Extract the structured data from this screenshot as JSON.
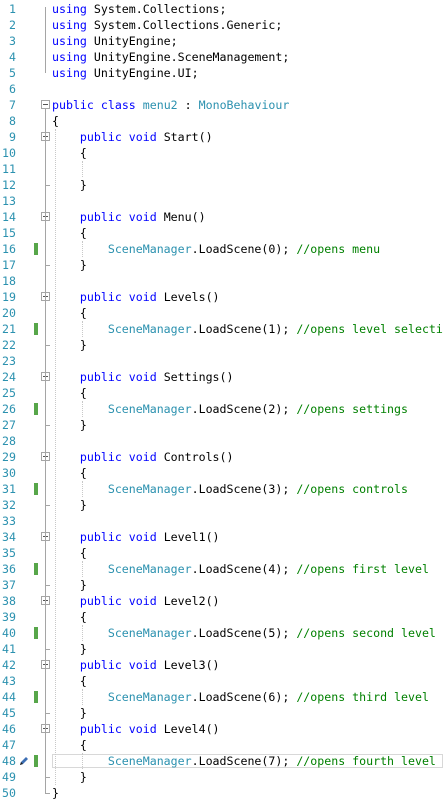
{
  "lines": [
    {
      "n": "1",
      "indent": "",
      "parts": [
        {
          "c": "kw",
          "t": "using"
        },
        {
          "c": "",
          "t": " System.Collections;"
        }
      ]
    },
    {
      "n": "2",
      "indent": "",
      "parts": [
        {
          "c": "kw",
          "t": "using"
        },
        {
          "c": "",
          "t": " System.Collections.Generic;"
        }
      ]
    },
    {
      "n": "3",
      "indent": "",
      "parts": [
        {
          "c": "kw",
          "t": "using"
        },
        {
          "c": "",
          "t": " UnityEngine;"
        }
      ]
    },
    {
      "n": "4",
      "indent": "",
      "parts": [
        {
          "c": "kw",
          "t": "using"
        },
        {
          "c": "",
          "t": " UnityEngine.SceneManagement;"
        }
      ]
    },
    {
      "n": "5",
      "indent": "",
      "parts": [
        {
          "c": "kw",
          "t": "using"
        },
        {
          "c": "",
          "t": " UnityEngine.UI;"
        }
      ]
    },
    {
      "n": "6",
      "indent": "",
      "parts": []
    },
    {
      "n": "7",
      "fold": true,
      "indent": "",
      "parts": [
        {
          "c": "kw",
          "t": "public"
        },
        {
          "c": "",
          "t": " "
        },
        {
          "c": "kw",
          "t": "class"
        },
        {
          "c": "",
          "t": " "
        },
        {
          "c": "ty",
          "t": "menu2"
        },
        {
          "c": "",
          "t": " : "
        },
        {
          "c": "ty",
          "t": "MonoBehaviour"
        }
      ]
    },
    {
      "n": "8",
      "indent": "",
      "parts": [
        {
          "c": "",
          "t": "{"
        }
      ]
    },
    {
      "n": "9",
      "fold": true,
      "indent": "    ",
      "parts": [
        {
          "c": "kw",
          "t": "public"
        },
        {
          "c": "",
          "t": " "
        },
        {
          "c": "kw",
          "t": "void"
        },
        {
          "c": "",
          "t": " Start()"
        }
      ]
    },
    {
      "n": "10",
      "indent": "    ",
      "parts": [
        {
          "c": "",
          "t": "{"
        }
      ]
    },
    {
      "n": "11",
      "indent": "",
      "parts": []
    },
    {
      "n": "12",
      "indent": "    ",
      "parts": [
        {
          "c": "",
          "t": "}"
        }
      ]
    },
    {
      "n": "13",
      "indent": "",
      "parts": []
    },
    {
      "n": "14",
      "fold": true,
      "indent": "    ",
      "parts": [
        {
          "c": "kw",
          "t": "public"
        },
        {
          "c": "",
          "t": " "
        },
        {
          "c": "kw",
          "t": "void"
        },
        {
          "c": "",
          "t": " Menu()"
        }
      ]
    },
    {
      "n": "15",
      "indent": "    ",
      "parts": [
        {
          "c": "",
          "t": "{"
        }
      ]
    },
    {
      "n": "16",
      "changed": true,
      "indent": "        ",
      "parts": [
        {
          "c": "ty",
          "t": "SceneManager"
        },
        {
          "c": "",
          "t": ".LoadScene(0); "
        },
        {
          "c": "cm",
          "t": "//opens menu"
        }
      ]
    },
    {
      "n": "17",
      "indent": "    ",
      "parts": [
        {
          "c": "",
          "t": "}"
        }
      ]
    },
    {
      "n": "18",
      "indent": "",
      "parts": []
    },
    {
      "n": "19",
      "fold": true,
      "indent": "    ",
      "parts": [
        {
          "c": "kw",
          "t": "public"
        },
        {
          "c": "",
          "t": " "
        },
        {
          "c": "kw",
          "t": "void"
        },
        {
          "c": "",
          "t": " Levels()"
        }
      ]
    },
    {
      "n": "20",
      "indent": "    ",
      "parts": [
        {
          "c": "",
          "t": "{"
        }
      ]
    },
    {
      "n": "21",
      "changed": true,
      "indent": "        ",
      "parts": [
        {
          "c": "ty",
          "t": "SceneManager"
        },
        {
          "c": "",
          "t": ".LoadScene(1); "
        },
        {
          "c": "cm",
          "t": "//opens level selection"
        }
      ]
    },
    {
      "n": "22",
      "indent": "    ",
      "parts": [
        {
          "c": "",
          "t": "}"
        }
      ]
    },
    {
      "n": "23",
      "indent": "",
      "parts": []
    },
    {
      "n": "24",
      "fold": true,
      "indent": "    ",
      "parts": [
        {
          "c": "kw",
          "t": "public"
        },
        {
          "c": "",
          "t": " "
        },
        {
          "c": "kw",
          "t": "void"
        },
        {
          "c": "",
          "t": " Settings()"
        }
      ]
    },
    {
      "n": "25",
      "indent": "    ",
      "parts": [
        {
          "c": "",
          "t": "{"
        }
      ]
    },
    {
      "n": "26",
      "changed": true,
      "indent": "        ",
      "parts": [
        {
          "c": "ty",
          "t": "SceneManager"
        },
        {
          "c": "",
          "t": ".LoadScene(2); "
        },
        {
          "c": "cm",
          "t": "//opens settings"
        }
      ]
    },
    {
      "n": "27",
      "indent": "    ",
      "parts": [
        {
          "c": "",
          "t": "}"
        }
      ]
    },
    {
      "n": "28",
      "indent": "",
      "parts": []
    },
    {
      "n": "29",
      "fold": true,
      "indent": "    ",
      "parts": [
        {
          "c": "kw",
          "t": "public"
        },
        {
          "c": "",
          "t": " "
        },
        {
          "c": "kw",
          "t": "void"
        },
        {
          "c": "",
          "t": " Controls()"
        }
      ]
    },
    {
      "n": "30",
      "indent": "    ",
      "parts": [
        {
          "c": "",
          "t": "{"
        }
      ]
    },
    {
      "n": "31",
      "changed": true,
      "indent": "        ",
      "parts": [
        {
          "c": "ty",
          "t": "SceneManager"
        },
        {
          "c": "",
          "t": ".LoadScene(3); "
        },
        {
          "c": "cm",
          "t": "//opens controls"
        }
      ]
    },
    {
      "n": "32",
      "indent": "    ",
      "parts": [
        {
          "c": "",
          "t": "}"
        }
      ]
    },
    {
      "n": "33",
      "indent": "",
      "parts": []
    },
    {
      "n": "34",
      "fold": true,
      "indent": "    ",
      "parts": [
        {
          "c": "kw",
          "t": "public"
        },
        {
          "c": "",
          "t": " "
        },
        {
          "c": "kw",
          "t": "void"
        },
        {
          "c": "",
          "t": " Level1()"
        }
      ]
    },
    {
      "n": "35",
      "indent": "    ",
      "parts": [
        {
          "c": "",
          "t": "{"
        }
      ]
    },
    {
      "n": "36",
      "changed": true,
      "indent": "        ",
      "parts": [
        {
          "c": "ty",
          "t": "SceneManager"
        },
        {
          "c": "",
          "t": ".LoadScene(4); "
        },
        {
          "c": "cm",
          "t": "//opens first level"
        }
      ]
    },
    {
      "n": "37",
      "indent": "    ",
      "parts": [
        {
          "c": "",
          "t": "}"
        }
      ]
    },
    {
      "n": "38",
      "fold": true,
      "indent": "    ",
      "parts": [
        {
          "c": "kw",
          "t": "public"
        },
        {
          "c": "",
          "t": " "
        },
        {
          "c": "kw",
          "t": "void"
        },
        {
          "c": "",
          "t": " Level2()"
        }
      ]
    },
    {
      "n": "39",
      "indent": "    ",
      "parts": [
        {
          "c": "",
          "t": "{"
        }
      ]
    },
    {
      "n": "40",
      "changed": true,
      "indent": "        ",
      "parts": [
        {
          "c": "ty",
          "t": "SceneManager"
        },
        {
          "c": "",
          "t": ".LoadScene(5); "
        },
        {
          "c": "cm",
          "t": "//opens second level"
        }
      ]
    },
    {
      "n": "41",
      "indent": "    ",
      "parts": [
        {
          "c": "",
          "t": "}"
        }
      ]
    },
    {
      "n": "42",
      "fold": true,
      "indent": "    ",
      "parts": [
        {
          "c": "kw",
          "t": "public"
        },
        {
          "c": "",
          "t": " "
        },
        {
          "c": "kw",
          "t": "void"
        },
        {
          "c": "",
          "t": " Level3()"
        }
      ]
    },
    {
      "n": "43",
      "indent": "    ",
      "parts": [
        {
          "c": "",
          "t": "{"
        }
      ]
    },
    {
      "n": "44",
      "changed": true,
      "indent": "        ",
      "parts": [
        {
          "c": "ty",
          "t": "SceneManager"
        },
        {
          "c": "",
          "t": ".LoadScene(6); "
        },
        {
          "c": "cm",
          "t": "//opens third level"
        }
      ]
    },
    {
      "n": "45",
      "indent": "    ",
      "parts": [
        {
          "c": "",
          "t": "}"
        }
      ]
    },
    {
      "n": "46",
      "fold": true,
      "indent": "    ",
      "parts": [
        {
          "c": "kw",
          "t": "public"
        },
        {
          "c": "",
          "t": " "
        },
        {
          "c": "kw",
          "t": "void"
        },
        {
          "c": "",
          "t": " Level4()"
        }
      ]
    },
    {
      "n": "47",
      "indent": "    ",
      "parts": [
        {
          "c": "",
          "t": "{"
        }
      ]
    },
    {
      "n": "48",
      "changed": true,
      "current": true,
      "indent": "        ",
      "parts": [
        {
          "c": "ty",
          "t": "SceneManager"
        },
        {
          "c": "",
          "t": ".LoadScene(7); "
        },
        {
          "c": "cm",
          "t": "//opens fourth level"
        }
      ]
    },
    {
      "n": "49",
      "indent": "    ",
      "parts": [
        {
          "c": "",
          "t": "}"
        }
      ]
    },
    {
      "n": "50",
      "indent": "",
      "parts": [
        {
          "c": "",
          "t": "}"
        }
      ]
    }
  ],
  "colors": {
    "keyword": "#0000ff",
    "type": "#2b91af",
    "comment": "#008000",
    "line_number": "#2b91af",
    "change_marker": "#57a64a"
  },
  "icons": {
    "current_line": "pencil-icon"
  }
}
